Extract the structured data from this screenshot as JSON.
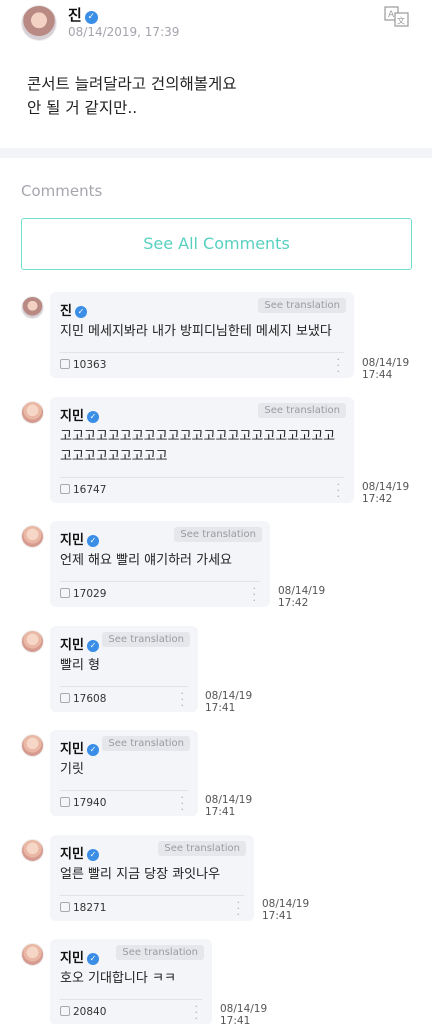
{
  "post": {
    "author": "진",
    "timestamp": "08/14/2019, 17:39",
    "body": "콘서트 늘려달라고 건의해볼게요\n안 될 거 같지만.."
  },
  "comments_section": {
    "label": "Comments",
    "see_all_label": "See All Comments"
  },
  "see_translation_label": "See translation",
  "comments": [
    {
      "author": "진",
      "text": "지민 메세지봐라 내가 방피디님한테 메세지 보냈다",
      "likes": "10363",
      "date": "08/14/19",
      "time": "17:44"
    },
    {
      "author": "지민",
      "text": "고고고고고고고고고고고고고고고고고고고고고고고고고고고고고고고고",
      "likes": "16747",
      "date": "08/14/19",
      "time": "17:42"
    },
    {
      "author": "지민",
      "text": "언제 해요 빨리 얘기하러 가세요",
      "likes": "17029",
      "date": "08/14/19",
      "time": "17:42"
    },
    {
      "author": "지민",
      "text": "빨리 형",
      "likes": "17608",
      "date": "08/14/19",
      "time": "17:41"
    },
    {
      "author": "지민",
      "text": "기릿",
      "likes": "17940",
      "date": "08/14/19",
      "time": "17:41"
    },
    {
      "author": "지민",
      "text": "얼른 빨리 지금 당장 콰잇나우",
      "likes": "18271",
      "date": "08/14/19",
      "time": "17:41"
    },
    {
      "author": "지민",
      "text": "호오 기대합니다 ㅋㅋ",
      "likes": "20840",
      "date": "08/14/19",
      "time": "17:41"
    }
  ]
}
